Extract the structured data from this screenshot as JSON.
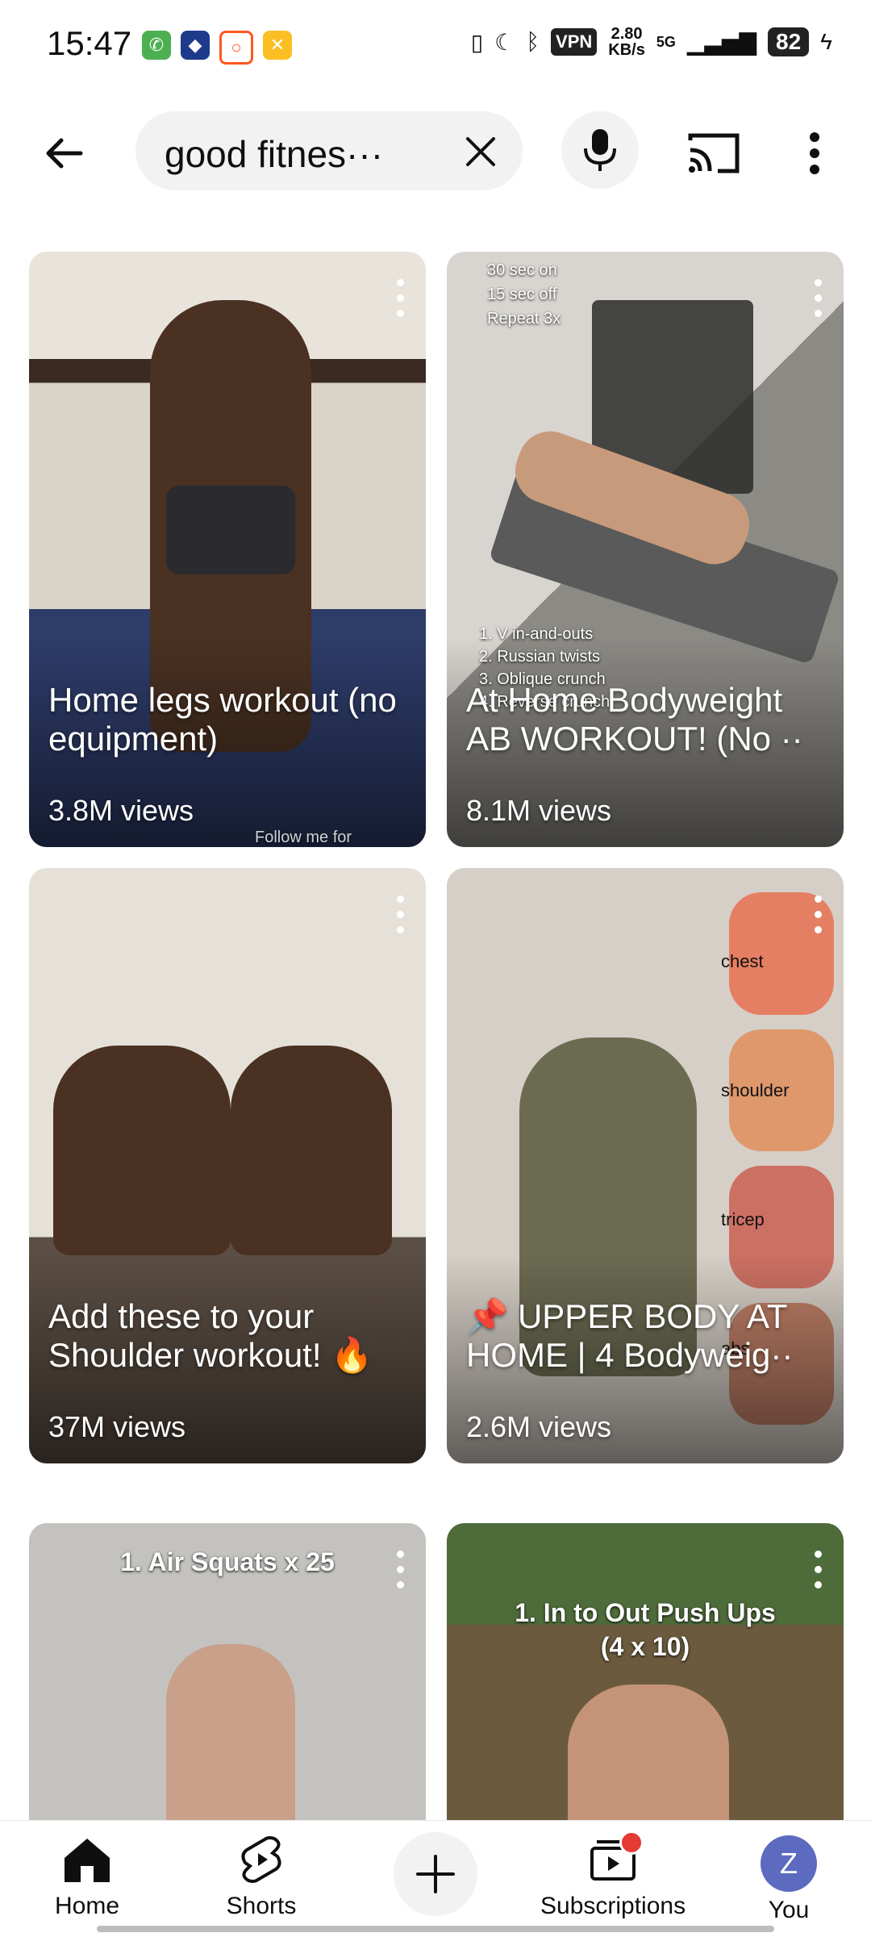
{
  "status_bar": {
    "time": "15:47",
    "vpn": "VPN",
    "speed_value": "2.80",
    "speed_unit": "KB/s",
    "network": "5G",
    "battery": "82"
  },
  "search": {
    "query": "good fitnes···"
  },
  "cards": [
    {
      "title": "Home legs workout (no equipment)",
      "views": "3.8M views",
      "overlay": "",
      "bg": "#6e5a4a"
    },
    {
      "title": "At Home Bodyweight AB WORKOUT! (No ··",
      "views": "8.1M views",
      "overlay": "30 sec on\n15 sec off\nRepeat 3x",
      "bg": "#7d7b78"
    },
    {
      "title": "Add these to your Shoulder workout! 🔥",
      "views": "37M views",
      "overlay": "",
      "bg": "#8b7d6b"
    },
    {
      "title": "📌 UPPER BODY AT HOME | 4 Bodyweig··",
      "views": "2.6M views",
      "overlay": "chest\nshoulder\ntricep\nabs",
      "bg": "#cfc8c1"
    },
    {
      "title": "",
      "views": "",
      "overlay": "1. Air Squats x 25",
      "bg": "#b9b7b4"
    },
    {
      "title": "",
      "views": "",
      "overlay": "1. In to Out Push Ups\n(4 x 10)",
      "bg": "#6b5a3e"
    }
  ],
  "ab_steps": "1. V in-and-outs\n2. Russian twists\n3. Oblique crunch\n4. Reverse crunch",
  "watermark_1": "Follow me for",
  "nav": {
    "home": "Home",
    "shorts": "Shorts",
    "subscriptions": "Subscriptions",
    "you": "You",
    "avatar_letter": "Z"
  }
}
